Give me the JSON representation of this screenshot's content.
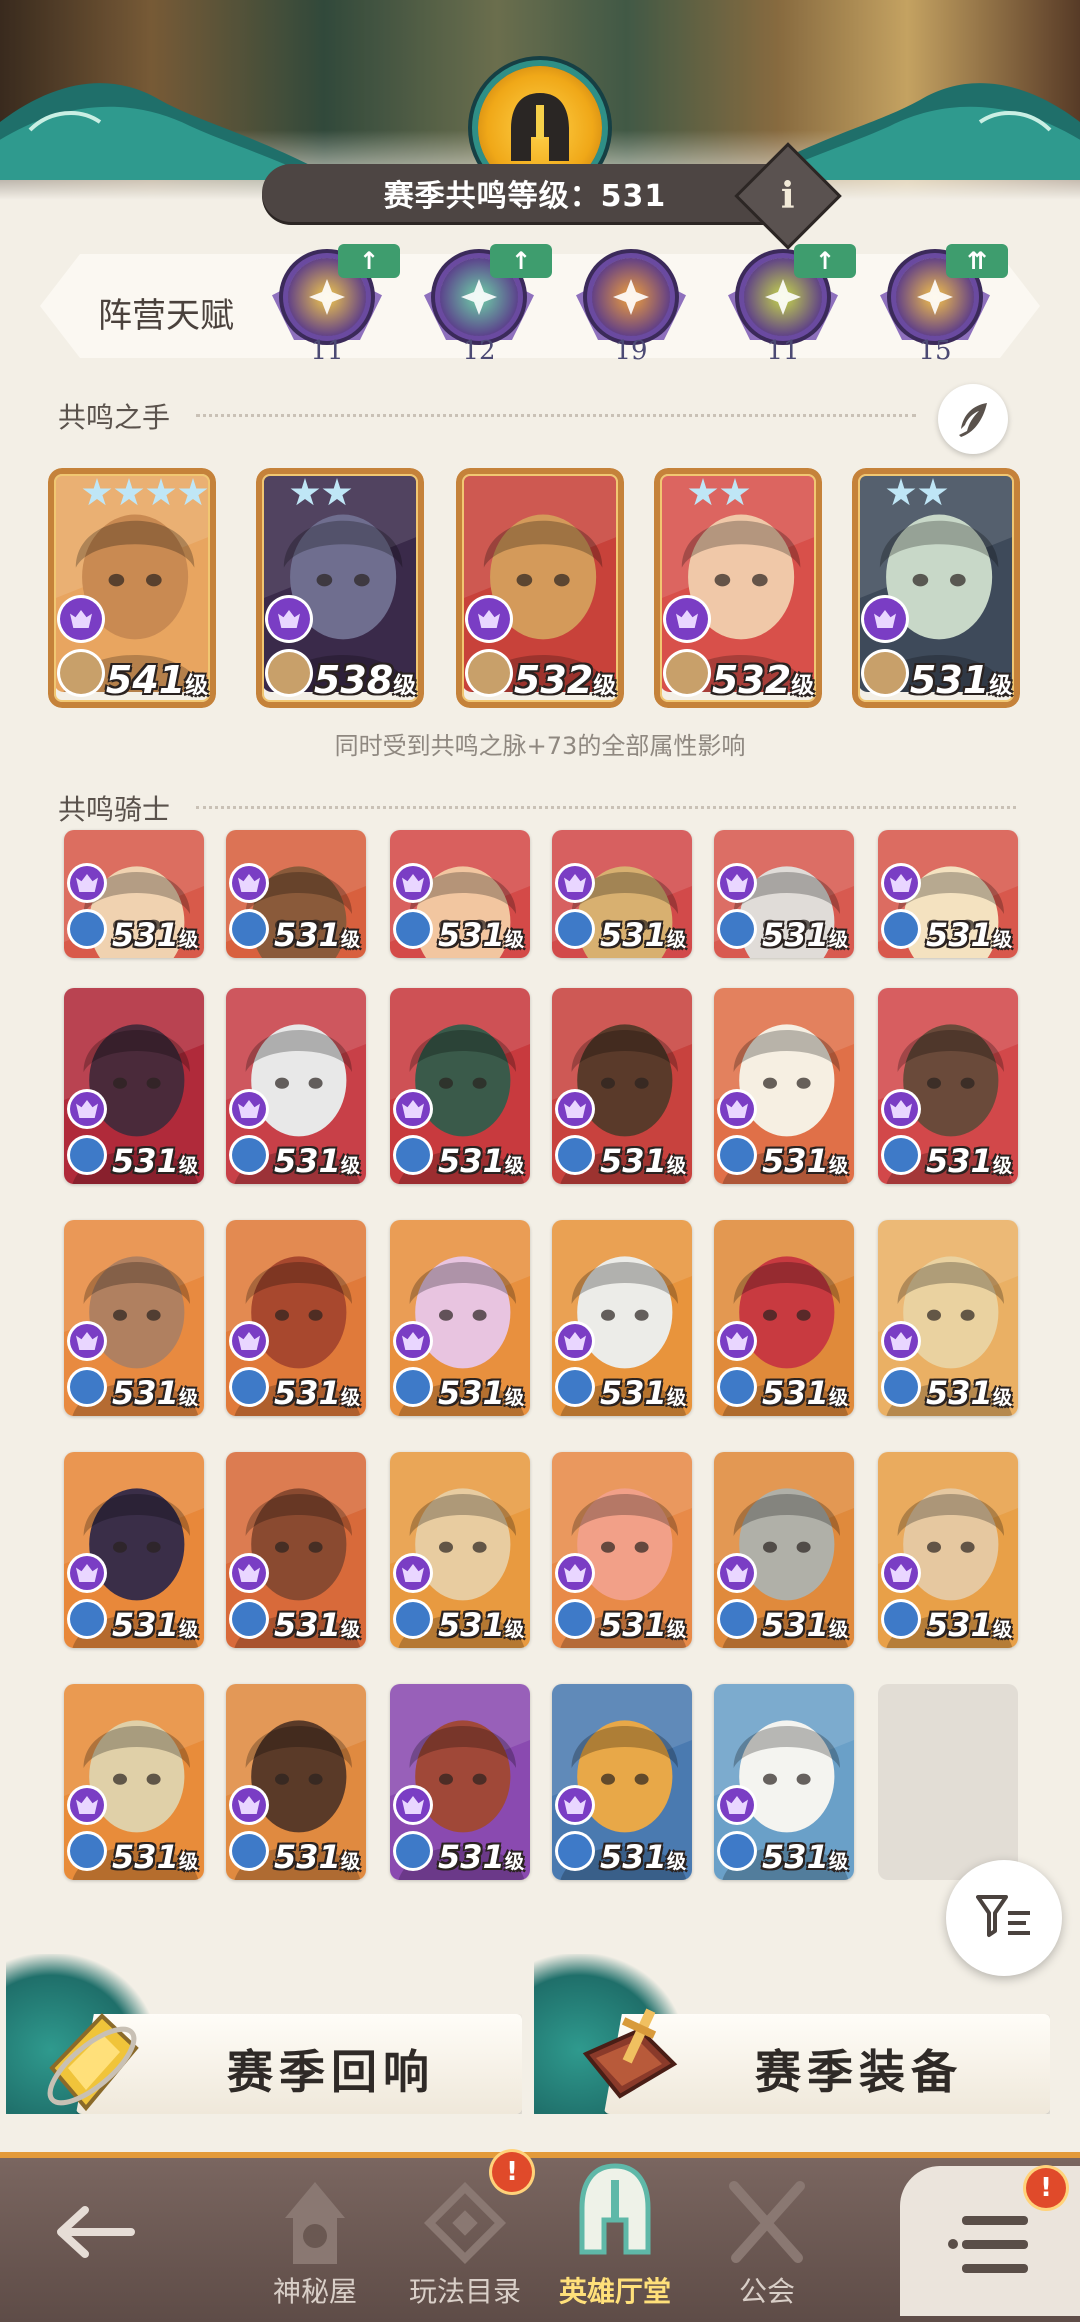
{
  "header": {
    "resonance_label": "赛季共鸣等级：531",
    "info_glyph": "i"
  },
  "faction_talent": {
    "title": "阵营天赋",
    "factions": [
      {
        "icon": "lightbearer-icon",
        "level": "11",
        "upgrade": "up",
        "color": "#f2c94c"
      },
      {
        "icon": "wilder-icon",
        "level": "12",
        "upgrade": "up",
        "color": "#6fd3a8"
      },
      {
        "icon": "mauler-icon",
        "level": "19",
        "upgrade": "",
        "color": "#f0a03c"
      },
      {
        "icon": "graveborn-icon",
        "level": "11",
        "upgrade": "up",
        "color": "#c7d84a"
      },
      {
        "icon": "celestial-icon",
        "level": "15",
        "upgrade": "double-up",
        "color": "#f5c24a"
      }
    ]
  },
  "hands_section": {
    "title": "共鸣之手",
    "hint": "同时受到共鸣之脉+73的全部属性影响",
    "cards": [
      {
        "level": "541",
        "unit": "级",
        "stars": 4,
        "bg": "#e8a560",
        "skin": "#c98a52"
      },
      {
        "level": "538",
        "unit": "级",
        "stars": 2,
        "bg": "#3a2a4a",
        "skin": "#6f6e8f"
      },
      {
        "level": "532",
        "unit": "级",
        "stars": 0,
        "bg": "#c8423a",
        "skin": "#d49a5a"
      },
      {
        "level": "532",
        "unit": "级",
        "stars": 2,
        "bg": "#d8504a",
        "skin": "#f0c8a8"
      },
      {
        "level": "531",
        "unit": "级",
        "stars": 2,
        "bg": "#3e4a5a",
        "skin": "#c8d8c8"
      }
    ]
  },
  "knights_section": {
    "title": "共鸣骑士",
    "cards": [
      {
        "level": "531",
        "unit": "级",
        "bg": "#d85a4a",
        "skin": "#f0d2b0"
      },
      {
        "level": "531",
        "unit": "级",
        "bg": "#d8603e",
        "skin": "#8a5a3a"
      },
      {
        "level": "531",
        "unit": "级",
        "bg": "#d44a48",
        "skin": "#f2c6a0"
      },
      {
        "level": "531",
        "unit": "级",
        "bg": "#d24a4a",
        "skin": "#d8b070"
      },
      {
        "level": "531",
        "unit": "级",
        "bg": "#d85a50",
        "skin": "#e0dcd8"
      },
      {
        "level": "531",
        "unit": "级",
        "bg": "#d8584c",
        "skin": "#f4e2c0"
      },
      {
        "level": "531",
        "unit": "级",
        "bg": "#b02a3a",
        "skin": "#4a2a3a"
      },
      {
        "level": "531",
        "unit": "级",
        "bg": "#c84048",
        "skin": "#e8e8e8"
      },
      {
        "level": "531",
        "unit": "级",
        "bg": "#c83a3e",
        "skin": "#3a5a4a"
      },
      {
        "level": "531",
        "unit": "级",
        "bg": "#c8423e",
        "skin": "#5a3a2a"
      },
      {
        "level": "531",
        "unit": "级",
        "bg": "#e07048",
        "skin": "#f6efe2"
      },
      {
        "level": "531",
        "unit": "级",
        "bg": "#d2484a",
        "skin": "#6a4a3a"
      },
      {
        "level": "531",
        "unit": "级",
        "bg": "#e88a40",
        "skin": "#b08060"
      },
      {
        "level": "531",
        "unit": "级",
        "bg": "#e07a3a",
        "skin": "#a8482e"
      },
      {
        "level": "531",
        "unit": "级",
        "bg": "#e8903e",
        "skin": "#e8c4e0"
      },
      {
        "level": "531",
        "unit": "级",
        "bg": "#e8943c",
        "skin": "#ecece8"
      },
      {
        "level": "531",
        "unit": "级",
        "bg": "#e08a3a",
        "skin": "#c83a40"
      },
      {
        "level": "531",
        "unit": "级",
        "bg": "#eab064",
        "skin": "#ead2a0"
      },
      {
        "level": "531",
        "unit": "级",
        "bg": "#e8883a",
        "skin": "#3a2e48"
      },
      {
        "level": "531",
        "unit": "级",
        "bg": "#d86a3a",
        "skin": "#8a4a30"
      },
      {
        "level": "531",
        "unit": "级",
        "bg": "#e89a40",
        "skin": "#e8cca0"
      },
      {
        "level": "531",
        "unit": "级",
        "bg": "#e88a48",
        "skin": "#f2a088"
      },
      {
        "level": "531",
        "unit": "级",
        "bg": "#e08a3c",
        "skin": "#b0b0a8"
      },
      {
        "level": "531",
        "unit": "级",
        "bg": "#e8a048",
        "skin": "#e6c8a0"
      },
      {
        "level": "531",
        "unit": "级",
        "bg": "#e88c3a",
        "skin": "#e0d0a8"
      },
      {
        "level": "531",
        "unit": "级",
        "bg": "#e08a40",
        "skin": "#5a3a28"
      },
      {
        "level": "531",
        "unit": "级",
        "bg": "#8a4ab0",
        "skin": "#a04838"
      },
      {
        "level": "531",
        "unit": "级",
        "bg": "#4a7ab0",
        "skin": "#e8a848"
      },
      {
        "level": "531",
        "unit": "级",
        "bg": "#6aa0c8",
        "skin": "#f4f4f0"
      }
    ]
  },
  "features": {
    "echo_label": "赛季回响",
    "equipment_label": "赛季装备"
  },
  "nav": {
    "items": [
      {
        "label": "神秘屋"
      },
      {
        "label": "玩法目录"
      },
      {
        "label": "英雄厅堂"
      },
      {
        "label": "公会"
      }
    ],
    "alert_glyph": "!"
  }
}
